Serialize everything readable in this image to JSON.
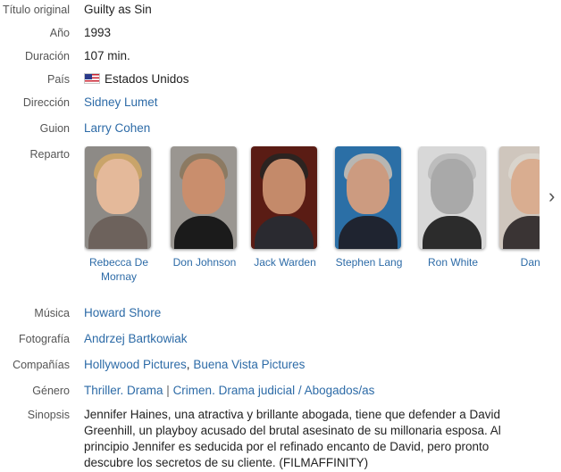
{
  "fields": {
    "titulo": {
      "label": "Título original",
      "value": "Guilty as Sin"
    },
    "anio": {
      "label": "Año",
      "value": "1993"
    },
    "duracion": {
      "label": "Duración",
      "value": "107 min."
    },
    "pais": {
      "label": "País",
      "value": "Estados Unidos",
      "flag_icon": "us-flag-icon"
    },
    "direccion": {
      "label": "Dirección",
      "value": "Sidney Lumet"
    },
    "guion": {
      "label": "Guion",
      "value": "Larry Cohen"
    },
    "reparto": {
      "label": "Reparto"
    },
    "musica": {
      "label": "Música",
      "value": "Howard Shore"
    },
    "fotografia": {
      "label": "Fotografía",
      "value": "Andrzej Bartkowiak"
    },
    "companias": {
      "label": "Compañías",
      "items": [
        "Hollywood Pictures",
        "Buena Vista Pictures"
      ],
      "separator": ","
    },
    "genero": {
      "label": "Género",
      "items": [
        "Thriller. Drama",
        "Crimen. Drama judicial / Abogados/as"
      ],
      "separator": "|"
    },
    "sinopsis": {
      "label": "Sinopsis",
      "value": "Jennifer Haines, una atractiva y brillante abogada, tiene que defender a David Greenhill, un playboy acusado del brutal asesinato de su millonaria esposa. Al principio Jennifer es seducida por el refinado encanto de David, pero pronto descubre los secretos de su cliente. (FILMAFFINITY)"
    }
  },
  "cast": [
    {
      "name": "Rebecca De Mornay",
      "bg": "#8d8a86",
      "hair": "#c9a46a",
      "skin": "#e4b99a",
      "cloth": "#6d625c"
    },
    {
      "name": "Don Johnson",
      "bg": "#9a9691",
      "hair": "#8c7a62",
      "skin": "#c98e6d",
      "cloth": "#1b1b1b"
    },
    {
      "name": "Jack Warden",
      "bg": "#5a1c14",
      "hair": "#2c2320",
      "skin": "#c48a6a",
      "cloth": "#2a2a30"
    },
    {
      "name": "Stephen Lang",
      "bg": "#2b6fa6",
      "hair": "#b8b6b2",
      "skin": "#cc9b80",
      "cloth": "#1f2430"
    },
    {
      "name": "Ron White",
      "bg": "#d8d8d8",
      "hair": "#bdbdbd",
      "skin": "#a9a9a9",
      "cloth": "#2c2c2c"
    },
    {
      "name": "Dana",
      "bg": "#cfc6bd",
      "hair": "#d9d4cc",
      "skin": "#d9ad90",
      "cloth": "#3a3434"
    }
  ],
  "carousel": {
    "next_icon": "chevron-right-icon",
    "next_glyph": "›"
  }
}
